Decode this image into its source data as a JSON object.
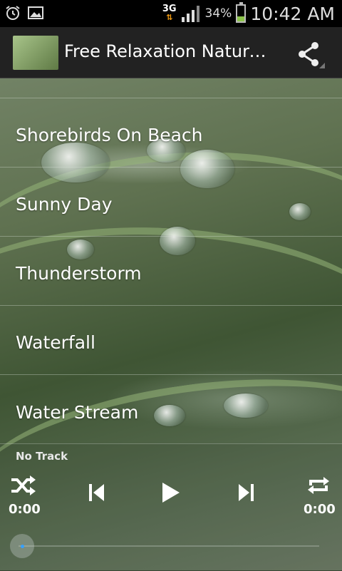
{
  "status_bar": {
    "network": "3G",
    "battery_percent": "34%",
    "time": "10:42 AM"
  },
  "action_bar": {
    "title": "Free Relaxation Nature Sounds"
  },
  "sounds": [
    {
      "label": ""
    },
    {
      "label": "Shorebirds On Beach"
    },
    {
      "label": "Sunny Day"
    },
    {
      "label": "Thunderstorm"
    },
    {
      "label": "Waterfall"
    },
    {
      "label": "Water Stream"
    }
  ],
  "player": {
    "track": "No Track",
    "elapsed": "0:00",
    "total": "0:00",
    "progress": 0
  },
  "icons": [
    "alarm-icon",
    "image-icon",
    "signal-icon",
    "battery-icon",
    "app-icon",
    "share-icon",
    "shuffle-icon",
    "previous-icon",
    "play-icon",
    "next-icon",
    "repeat-icon"
  ]
}
